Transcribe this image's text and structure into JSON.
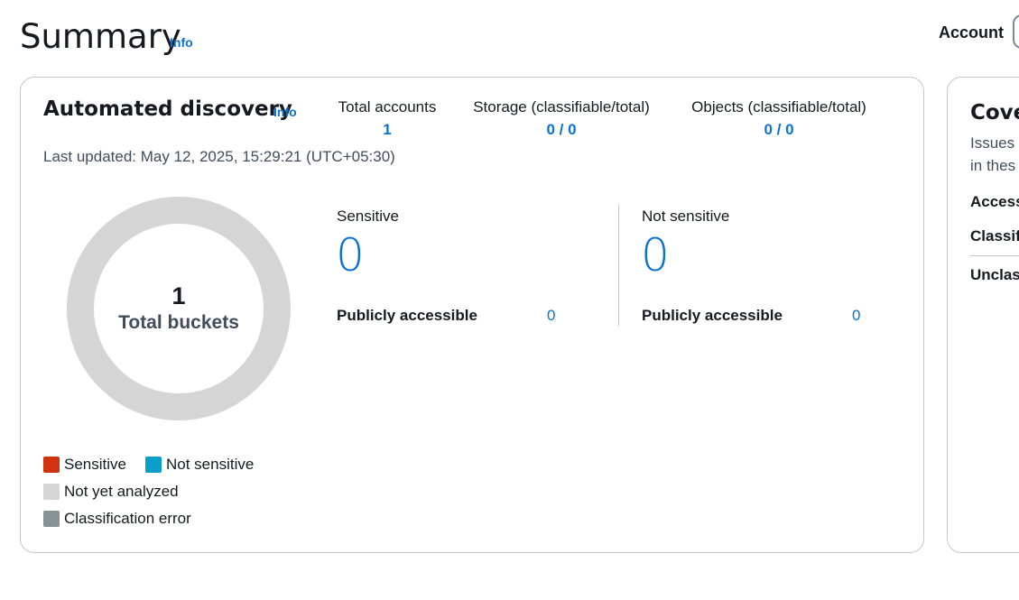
{
  "header": {
    "title": "Summary",
    "info": "Info",
    "account_label": "Account"
  },
  "discovery": {
    "title": "Automated discovery",
    "info": "Info",
    "last_updated": "Last updated: May 12, 2025, 15:29:21 (UTC+05:30)",
    "stats": [
      {
        "label": "Total accounts",
        "value": "1"
      },
      {
        "label": "Storage (classifiable/total)",
        "value": "0 / 0"
      },
      {
        "label": "Objects (classifiable/total)",
        "value": "0 / 0"
      }
    ],
    "donut": {
      "count": "1",
      "label": "Total buckets",
      "segments": [
        {
          "name": "Sensitive",
          "value": 0,
          "color": "#d13212"
        },
        {
          "name": "Not sensitive",
          "value": 0,
          "color": "#0a9fc8"
        },
        {
          "name": "Not yet analyzed",
          "value": 1,
          "color": "#d5d5d5"
        },
        {
          "name": "Classification error",
          "value": 0,
          "color": "#879196"
        }
      ]
    },
    "sensitive": {
      "label": "Sensitive",
      "value": "0",
      "public_label": "Publicly accessible",
      "public_value": "0"
    },
    "not_sensitive": {
      "label": "Not sensitive",
      "value": "0",
      "public_label": "Publicly accessible",
      "public_value": "0"
    },
    "legend": [
      {
        "label": "Sensitive",
        "color": "#d13212"
      },
      {
        "label": "Not sensitive",
        "color": "#0a9fc8"
      },
      {
        "label": "Not yet analyzed",
        "color": "#d5d5d5"
      },
      {
        "label": "Classification error",
        "color": "#879196"
      }
    ]
  },
  "coverage": {
    "title": "Cover",
    "desc_line1": "Issues p",
    "desc_line2": "in thes",
    "rows": [
      "Access",
      "Classif",
      "Unclas"
    ]
  }
}
